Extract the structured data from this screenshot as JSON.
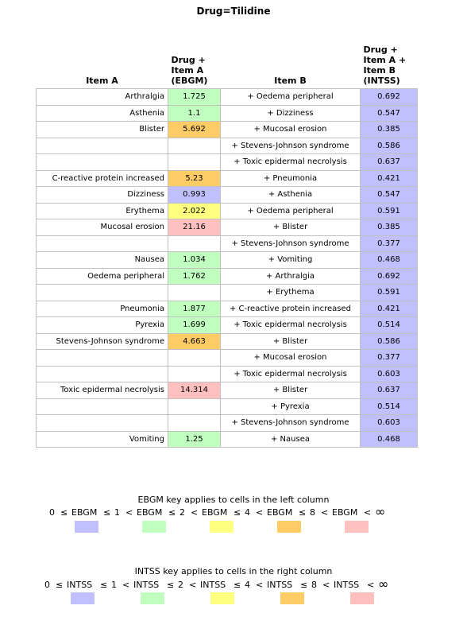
{
  "title": "Drug=Tilidine",
  "headers": {
    "item_a": "Item A",
    "ebgm": [
      "Drug +",
      "Item A",
      "(EBGM)"
    ],
    "item_b": "Item B",
    "intss": [
      "Drug +",
      "Item A +",
      "Item B",
      "(INTSS)"
    ]
  },
  "colors": {
    "band1": "#c0c0ff",
    "band2": "#c0ffc0",
    "band3": "#ffff80",
    "band4": "#ffcc66",
    "band5": "#ffc0c0"
  },
  "rows": [
    {
      "item_a": "Arthralgia",
      "ebgm": "1.725",
      "ebgm_band": 2,
      "item_b": "+ Oedema peripheral",
      "intss": "0.692"
    },
    {
      "item_a": "Asthenia",
      "ebgm": "1.1",
      "ebgm_band": 2,
      "item_b": "+ Dizziness",
      "intss": "0.547"
    },
    {
      "item_a": "Blister",
      "ebgm": "5.692",
      "ebgm_band": 4,
      "item_b": "+ Mucosal erosion",
      "intss": "0.385"
    },
    {
      "item_a": "",
      "ebgm": "",
      "ebgm_band": 0,
      "item_b": "+ Stevens-Johnson syndrome",
      "intss": "0.586"
    },
    {
      "item_a": "",
      "ebgm": "",
      "ebgm_band": 0,
      "item_b": "+ Toxic epidermal necrolysis",
      "intss": "0.637"
    },
    {
      "item_a": "C-reactive protein increased",
      "ebgm": "5.23",
      "ebgm_band": 4,
      "item_b": "+ Pneumonia",
      "intss": "0.421"
    },
    {
      "item_a": "Dizziness",
      "ebgm": "0.993",
      "ebgm_band": 1,
      "item_b": "+ Asthenia",
      "intss": "0.547"
    },
    {
      "item_a": "Erythema",
      "ebgm": "2.022",
      "ebgm_band": 3,
      "item_b": "+ Oedema peripheral",
      "intss": "0.591"
    },
    {
      "item_a": "Mucosal erosion",
      "ebgm": "21.16",
      "ebgm_band": 5,
      "item_b": "+ Blister",
      "intss": "0.385"
    },
    {
      "item_a": "",
      "ebgm": "",
      "ebgm_band": 0,
      "item_b": "+ Stevens-Johnson syndrome",
      "intss": "0.377"
    },
    {
      "item_a": "Nausea",
      "ebgm": "1.034",
      "ebgm_band": 2,
      "item_b": "+ Vomiting",
      "intss": "0.468"
    },
    {
      "item_a": "Oedema peripheral",
      "ebgm": "1.762",
      "ebgm_band": 2,
      "item_b": "+ Arthralgia",
      "intss": "0.692"
    },
    {
      "item_a": "",
      "ebgm": "",
      "ebgm_band": 0,
      "item_b": "+ Erythema",
      "intss": "0.591"
    },
    {
      "item_a": "Pneumonia",
      "ebgm": "1.877",
      "ebgm_band": 2,
      "item_b": "+ C-reactive protein increased",
      "intss": "0.421"
    },
    {
      "item_a": "Pyrexia",
      "ebgm": "1.699",
      "ebgm_band": 2,
      "item_b": "+ Toxic epidermal necrolysis",
      "intss": "0.514"
    },
    {
      "item_a": "Stevens-Johnson syndrome",
      "ebgm": "4.663",
      "ebgm_band": 4,
      "item_b": "+ Blister",
      "intss": "0.586"
    },
    {
      "item_a": "",
      "ebgm": "",
      "ebgm_band": 0,
      "item_b": "+ Mucosal erosion",
      "intss": "0.377"
    },
    {
      "item_a": "",
      "ebgm": "",
      "ebgm_band": 0,
      "item_b": "+ Toxic epidermal necrolysis",
      "intss": "0.603"
    },
    {
      "item_a": "Toxic epidermal necrolysis",
      "ebgm": "14.314",
      "ebgm_band": 5,
      "item_b": "+ Blister",
      "intss": "0.637"
    },
    {
      "item_a": "",
      "ebgm": "",
      "ebgm_band": 0,
      "item_b": "+ Pyrexia",
      "intss": "0.514"
    },
    {
      "item_a": "",
      "ebgm": "",
      "ebgm_band": 0,
      "item_b": "+ Stevens-Johnson syndrome",
      "intss": "0.603"
    },
    {
      "item_a": "Vomiting",
      "ebgm": "1.25",
      "ebgm_band": 2,
      "item_b": "+ Nausea",
      "intss": "0.468"
    }
  ],
  "ebgm_key": {
    "caption": "EBGM key applies to cells in the left column",
    "tokens": [
      "0",
      "≤",
      "EBGM",
      "≤",
      "1",
      "<",
      "EBGM",
      "≤",
      "2",
      "<",
      "EBGM",
      "≤",
      "4",
      "<",
      "EBGM",
      "≤",
      "8",
      "<",
      "EBGM",
      "<",
      "∞"
    ]
  },
  "intss_key": {
    "caption": "INTSS key applies to cells in the right column",
    "tokens": [
      "0",
      "≤",
      "INTSS",
      "≤",
      "1",
      "<",
      "INTSS",
      "≤",
      "2",
      "<",
      "INTSS",
      "≤",
      "4",
      "<",
      "INTSS",
      "≤",
      "8",
      "<",
      "INTSS",
      "<",
      "∞"
    ]
  }
}
